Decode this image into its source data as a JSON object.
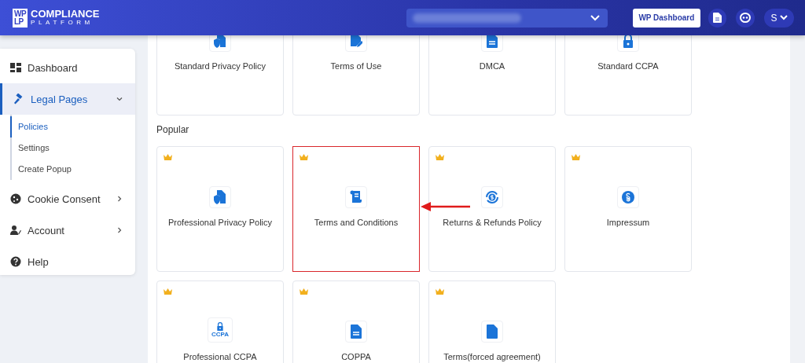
{
  "header": {
    "logo_mark": [
      "WP",
      "LP"
    ],
    "logo_title": "COMPLIANCE",
    "logo_subtitle": "PLATFORM",
    "wp_dashboard": "WP Dashboard",
    "user_initial": "S"
  },
  "sidebar": {
    "items": [
      {
        "label": "Dashboard",
        "kind": "dashboard",
        "selected": false
      },
      {
        "label": "Legal Pages",
        "kind": "gavel",
        "selected": true,
        "expanded": true,
        "children": [
          {
            "label": "Policies",
            "selected": true
          },
          {
            "label": "Settings",
            "selected": false
          },
          {
            "label": "Create Popup",
            "selected": false
          }
        ]
      },
      {
        "label": "Cookie Consent",
        "kind": "cookie",
        "selected": false,
        "expanded": false
      },
      {
        "label": "Account",
        "kind": "account",
        "selected": false,
        "expanded": false
      },
      {
        "label": "Help",
        "kind": "help",
        "selected": false
      }
    ]
  },
  "top_cards": [
    {
      "label": "Standard Privacy Policy",
      "kind": "shield-doc",
      "highlighted": false
    },
    {
      "label": "Terms of Use",
      "kind": "doc-edit",
      "highlighted": false
    },
    {
      "label": "DMCA",
      "kind": "doc-lines",
      "highlighted": false
    },
    {
      "label": "Standard CCPA",
      "kind": "lock",
      "highlighted": false
    }
  ],
  "popular": {
    "heading": "Popular",
    "cards": [
      {
        "label": "Professional Privacy Policy",
        "kind": "shield-doc",
        "premium": true,
        "highlighted": false
      },
      {
        "label": "Terms and Conditions",
        "kind": "scroll",
        "premium": true,
        "highlighted": true
      },
      {
        "label": "Returns & Refunds Policy",
        "kind": "refund",
        "premium": true,
        "highlighted": false
      },
      {
        "label": "Impressum",
        "kind": "paragraph",
        "premium": true,
        "highlighted": false
      },
      {
        "label": "Professional CCPA",
        "kind": "lock",
        "icon_text": "CCPA",
        "premium": true,
        "highlighted": false
      },
      {
        "label": "COPPA",
        "kind": "doc-lines",
        "premium": true,
        "highlighted": false
      },
      {
        "label": "Terms(forced agreement)",
        "kind": "doc",
        "premium": true,
        "highlighted": false
      }
    ]
  }
}
